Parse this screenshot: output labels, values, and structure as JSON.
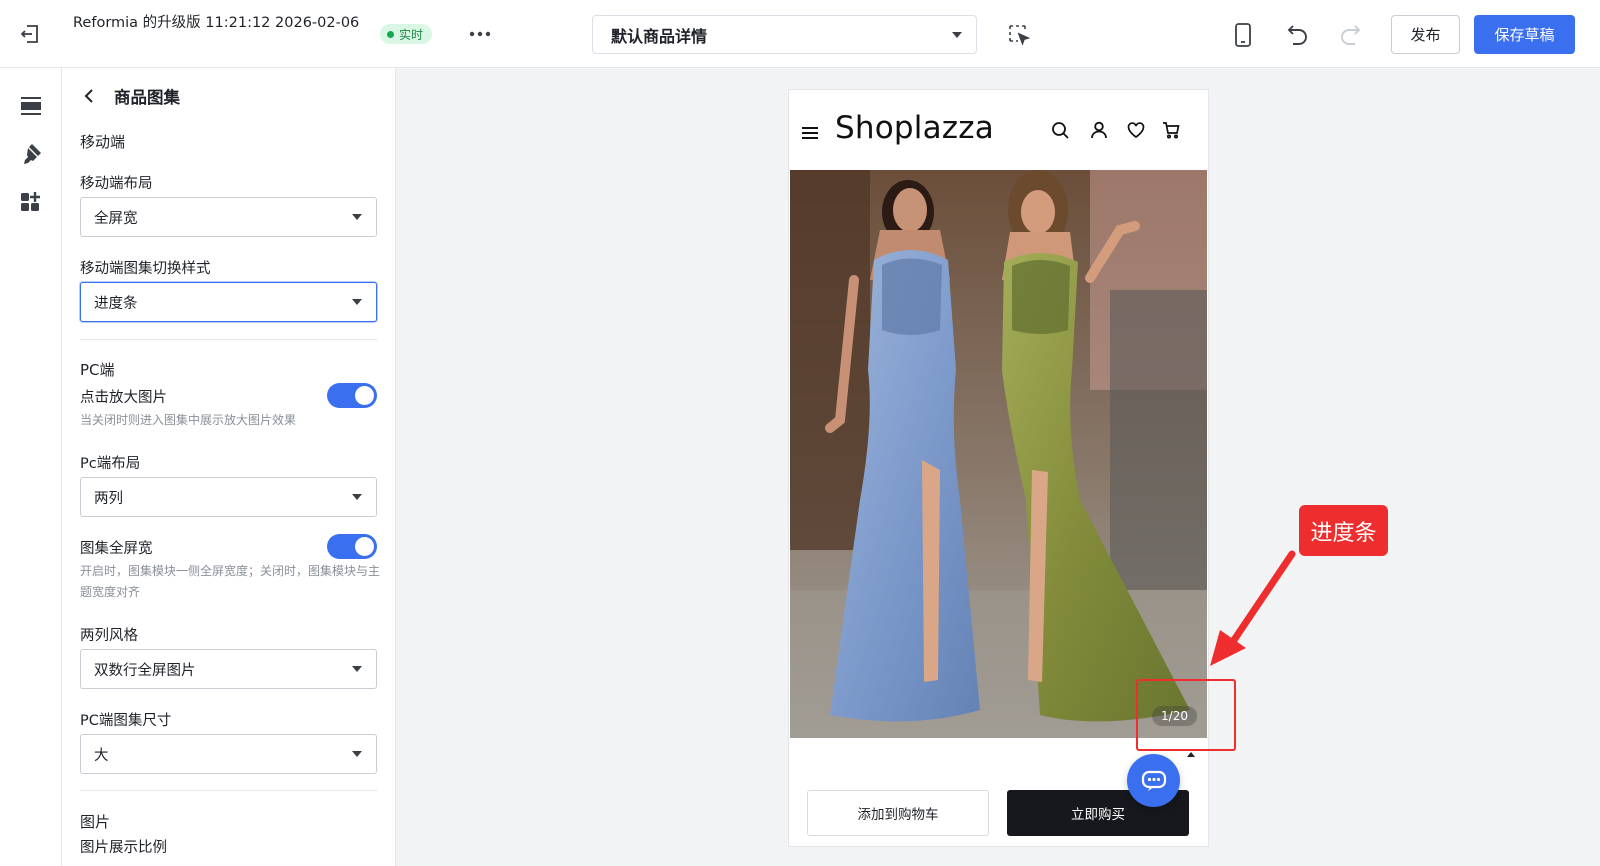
{
  "header": {
    "app_title": "Reformia 的升级版 11:21:12 2026-02-06",
    "live_badge": "实时",
    "page_select": "默认商品详情",
    "publish_label": "发布",
    "save_label": "保存草稿"
  },
  "panel": {
    "title": "商品图集",
    "mobile_section": "移动端",
    "mobile_layout_label": "移动端布局",
    "mobile_layout_value": "全屏宽",
    "mobile_switch_label": "移动端图集切换样式",
    "mobile_switch_value": "进度条",
    "pc_section": "PC端",
    "zoom_label": "点击放大图片",
    "zoom_on": true,
    "zoom_hint": "当关闭时则进入图集中展示放大图片效果",
    "pc_layout_label": "Pc端布局",
    "pc_layout_value": "两列",
    "fullwidth_label": "图集全屏宽",
    "fullwidth_on": true,
    "fullwidth_hint": "开启时，图集模块一侧全屏宽度；关闭时，图集模块与主题宽度对齐",
    "two_col_label": "两列风格",
    "two_col_value": "双数行全屏图片",
    "pc_size_label": "PC端图集尺寸",
    "pc_size_value": "大",
    "image_section": "图片",
    "image_ratio_label": "图片展示比例"
  },
  "preview": {
    "logo": "Shoplazza",
    "counter": "1/20",
    "add_to_cart": "添加到购物车",
    "buy_now": "立即购买"
  },
  "annotation": {
    "label": "进度条",
    "color": "#ee2e2e"
  },
  "colors": {
    "accent": "#3a6ff0",
    "live": "#19a651"
  }
}
